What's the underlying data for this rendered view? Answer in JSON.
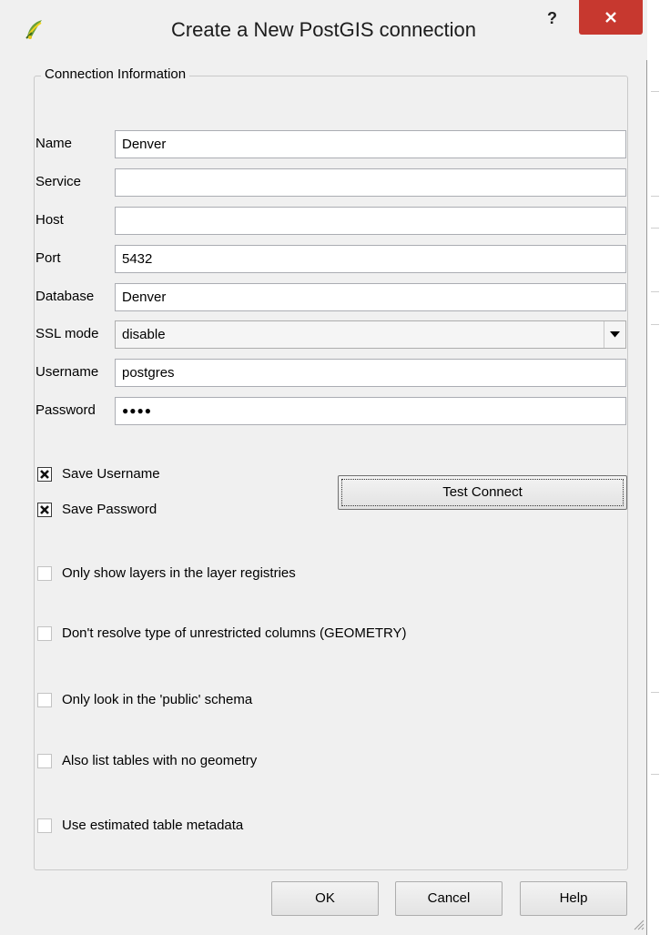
{
  "window": {
    "title": "Create a New PostGIS connection",
    "help_label": "?",
    "icons": {
      "app": "qgis-logo-icon",
      "close": "close-icon"
    },
    "close_color": "#c7382f"
  },
  "group": {
    "title": "Connection Information"
  },
  "fields": {
    "name": {
      "label": "Name",
      "value": "Denver"
    },
    "service": {
      "label": "Service",
      "value": ""
    },
    "host": {
      "label": "Host",
      "value": ""
    },
    "port": {
      "label": "Port",
      "value": "5432"
    },
    "database": {
      "label": "Database",
      "value": "Denver"
    },
    "ssl_mode": {
      "label": "SSL mode",
      "value": "disable"
    },
    "username": {
      "label": "Username",
      "value": "postgres"
    },
    "password": {
      "label": "Password",
      "value": "●●●●"
    }
  },
  "checkboxes": {
    "save_username": {
      "label": "Save Username",
      "checked": true
    },
    "save_password": {
      "label": "Save Password",
      "checked": true
    },
    "only_registries": {
      "label": "Only show layers in the layer registries",
      "checked": false
    },
    "dont_resolve": {
      "label": "Don't resolve type of unrestricted columns (GEOMETRY)",
      "checked": false
    },
    "only_public": {
      "label": "Only look in the 'public' schema",
      "checked": false
    },
    "no_geometry": {
      "label": "Also list tables with no geometry",
      "checked": false
    },
    "estimated_metadata": {
      "label": "Use estimated table metadata",
      "checked": false
    }
  },
  "buttons": {
    "test_connect": "Test Connect",
    "ok": "OK",
    "cancel": "Cancel",
    "help": "Help"
  }
}
